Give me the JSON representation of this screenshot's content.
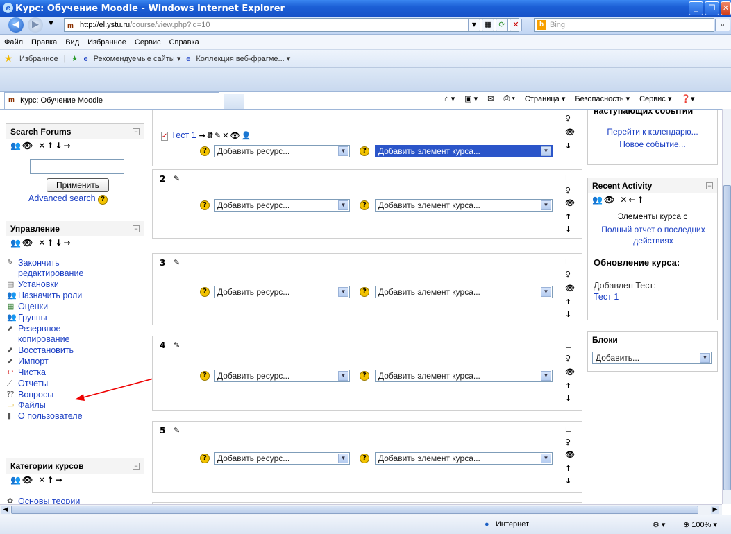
{
  "window": {
    "title": "Курс: Обучение Moodle - Windows Internet Explorer"
  },
  "address": {
    "host": "http://el.ystu.ru",
    "path": "/course/view.php?id=10",
    "search_placeholder": "Bing"
  },
  "menu": [
    "Файл",
    "Правка",
    "Вид",
    "Избранное",
    "Сервис",
    "Справка"
  ],
  "favorites": {
    "label": "Избранное",
    "links": [
      "Рекомендуемые сайты ▾",
      "Коллекция веб-фрагме... ▾"
    ]
  },
  "tab": {
    "label": "Курс: Обучение Moodle"
  },
  "commandbar": [
    "Страница ▾",
    "Безопасность ▾",
    "Сервис ▾"
  ],
  "search_forums": {
    "title": "Search Forums",
    "apply": "Применить",
    "advanced": "Advanced search"
  },
  "management": {
    "title": "Управление",
    "items": [
      "Закончить",
      "редактирование",
      "Установки",
      "Назначить роли",
      "Оценки",
      "Группы",
      "Резервное",
      "копирование",
      "Восстановить",
      "Импорт",
      "Чистка",
      "Отчеты",
      "Вопросы",
      "Файлы",
      "О пользователе"
    ]
  },
  "categories": {
    "title": "Категории курсов",
    "item": "Основы теории"
  },
  "topic1": {
    "test": "Тест 1"
  },
  "topics": [
    "2",
    "3",
    "4",
    "5"
  ],
  "select": {
    "resource": "Добавить ресурс...",
    "activity": "Добавить элемент курса..."
  },
  "events": {
    "title": "наступающих событий",
    "calendar": "Перейти к календарю...",
    "new": "Новое событие..."
  },
  "recent": {
    "title": "Recent Activity",
    "line1": "Элементы курса с",
    "full": "Полный отчет о последних действиях",
    "update": "Обновление курса:",
    "added": "Добавлен Тест:",
    "test": "Тест 1"
  },
  "blocks": {
    "title": "Блоки",
    "add": "Добавить..."
  },
  "status": {
    "zone": "Интернет",
    "zoom": "100%"
  }
}
